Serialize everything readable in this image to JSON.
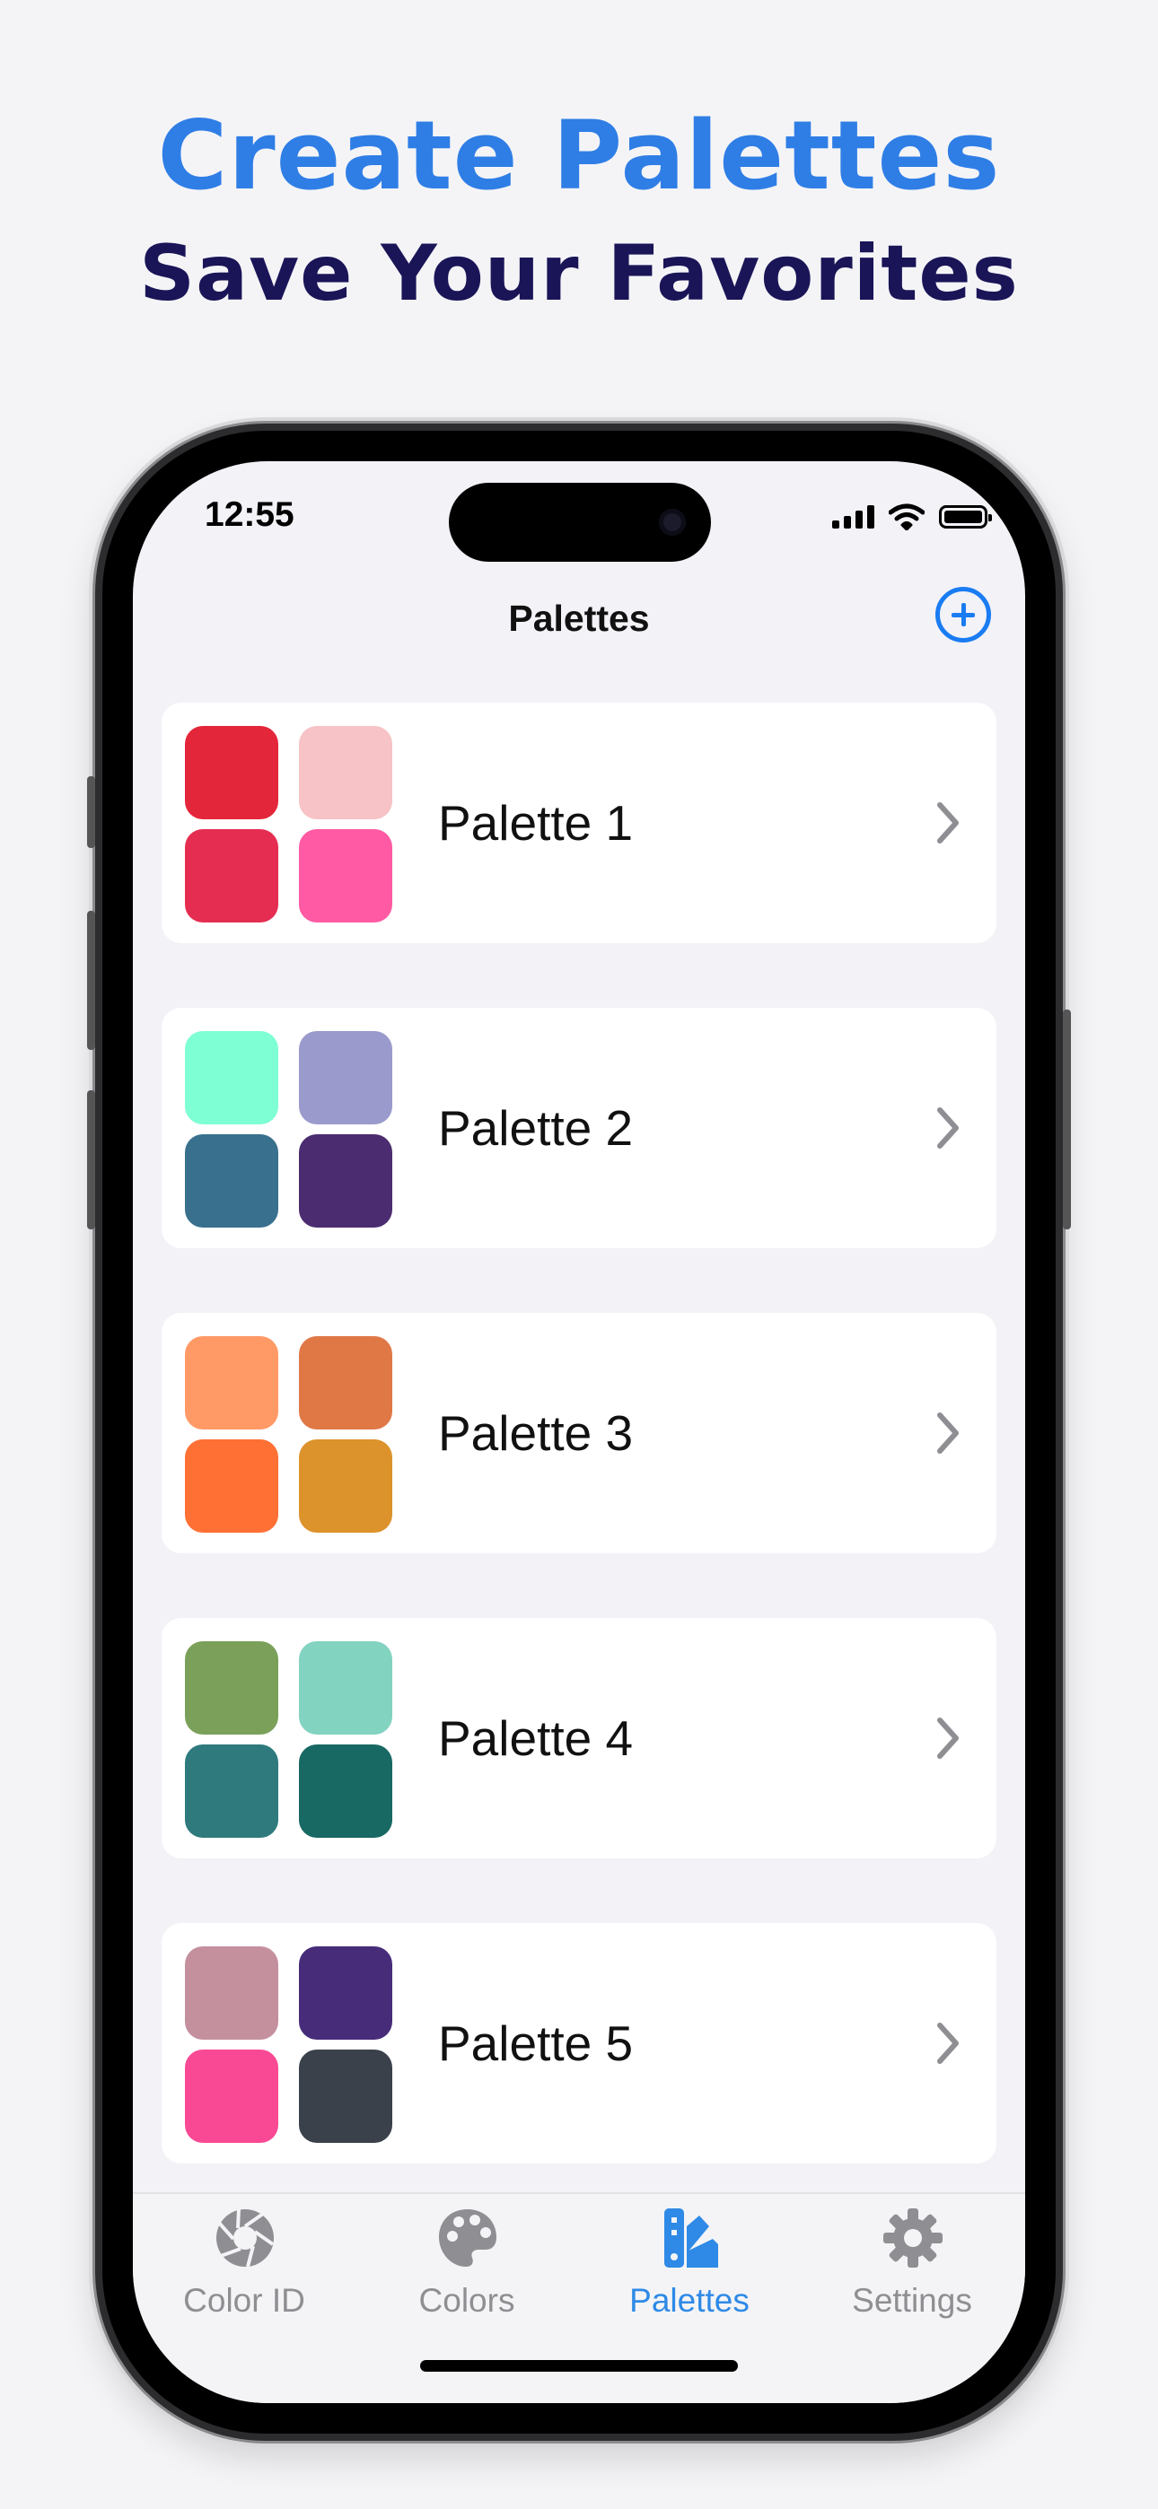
{
  "promo": {
    "headline": "Create Palettes",
    "subhead": "Save Your Favorites"
  },
  "status_bar": {
    "time": "12:55"
  },
  "nav": {
    "title": "Palettes",
    "add_icon": "plus-circle-icon"
  },
  "palettes": [
    {
      "label": "Palette 1",
      "colors": [
        "#e3263a",
        "#f7c3c6",
        "#e52d52",
        "#ff5aa3"
      ]
    },
    {
      "label": "Palette 2",
      "colors": [
        "#7fffd4",
        "#9a9acc",
        "#38708d",
        "#4b2c70"
      ]
    },
    {
      "label": "Palette 3",
      "colors": [
        "#ff9a66",
        "#e07846",
        "#ff7034",
        "#dc932b"
      ]
    },
    {
      "label": "Palette 4",
      "colors": [
        "#7aa05a",
        "#82d3c0",
        "#2e7a7d",
        "#186864"
      ]
    },
    {
      "label": "Palette 5",
      "colors": [
        "#c4909e",
        "#472c7a",
        "#f94995",
        "#3b414a"
      ]
    }
  ],
  "tabs": [
    {
      "label": "Color ID",
      "icon": "aperture-icon",
      "active": false
    },
    {
      "label": "Colors",
      "icon": "palette-icon",
      "active": false
    },
    {
      "label": "Palettes",
      "icon": "swatchbook-icon",
      "active": true
    },
    {
      "label": "Settings",
      "icon": "gear-icon",
      "active": false
    }
  ],
  "colors": {
    "accent": "#1a7cf2",
    "headline": "#2f7ee6",
    "subhead": "#1a1557",
    "inactive_tab": "#8e8e93"
  }
}
